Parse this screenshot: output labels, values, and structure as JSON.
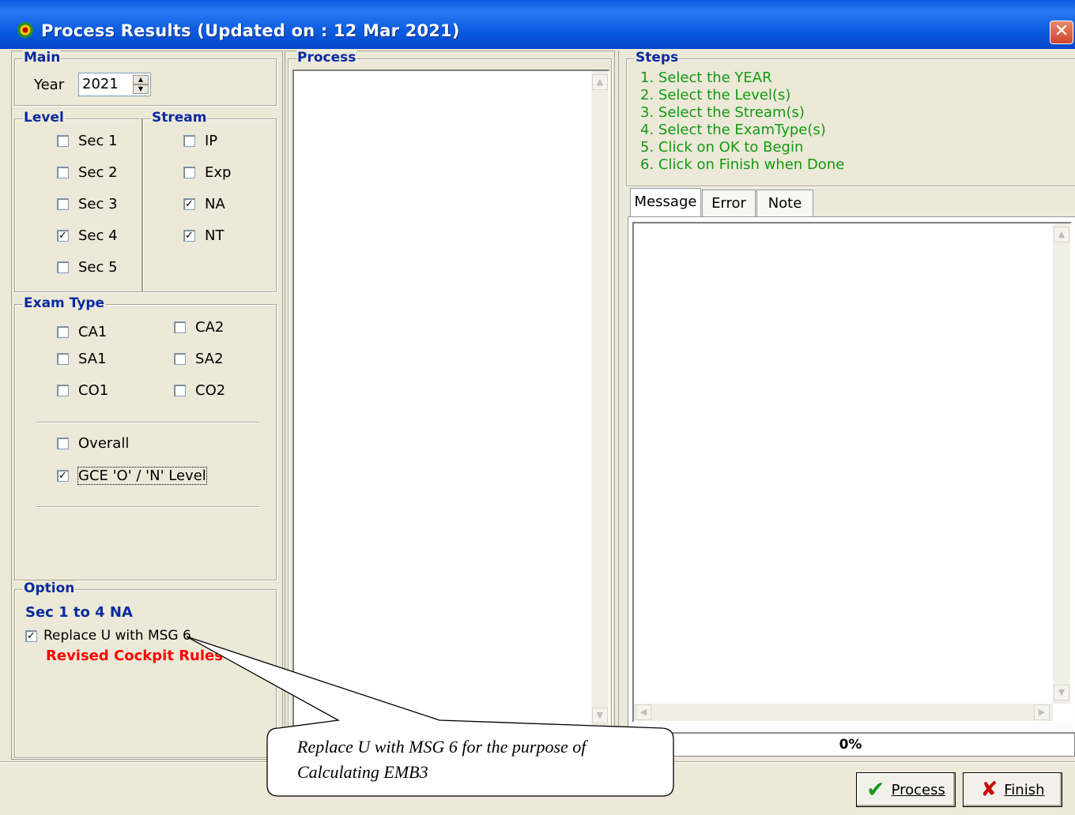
{
  "window": {
    "title": "Process Results (Updated on : 12 Mar 2021)",
    "close_label": "✕"
  },
  "main": {
    "legend": "Main",
    "year_label": "Year",
    "year_value": "2021"
  },
  "level": {
    "legend": "Level",
    "items": [
      {
        "label": "Sec 1",
        "checked": false
      },
      {
        "label": "Sec 2",
        "checked": false
      },
      {
        "label": "Sec 3",
        "checked": false
      },
      {
        "label": "Sec 4",
        "checked": true
      },
      {
        "label": "Sec 5",
        "checked": false
      }
    ]
  },
  "stream": {
    "legend": "Stream",
    "items": [
      {
        "label": "IP",
        "checked": false
      },
      {
        "label": "Exp",
        "checked": false
      },
      {
        "label": "NA",
        "checked": true
      },
      {
        "label": "NT",
        "checked": true
      }
    ]
  },
  "exam_type": {
    "legend": "Exam Type",
    "items": [
      {
        "label": "CA1",
        "checked": false
      },
      {
        "label": "CA2",
        "checked": false
      },
      {
        "label": "SA1",
        "checked": false
      },
      {
        "label": "SA2",
        "checked": false
      },
      {
        "label": "CO1",
        "checked": false
      },
      {
        "label": "CO2",
        "checked": false
      },
      {
        "label": "Overall",
        "checked": false
      },
      {
        "label": "GCE 'O' / 'N' Level",
        "checked": true
      }
    ]
  },
  "option": {
    "legend": "Option",
    "subtitle": "Sec 1 to 4 NA",
    "replace_label": "Replace U with MSG 6",
    "replace_checked": true,
    "rules_label": "Revised Cockpit Rules"
  },
  "process": {
    "legend": "Process"
  },
  "steps": {
    "legend": "Steps",
    "items": [
      "1.  Select the YEAR",
      "2.  Select the Level(s)",
      "3.  Select the Stream(s)",
      "4.  Select the ExamType(s)",
      "5.  Click on OK to Begin",
      "6.  Click on Finish when Done"
    ]
  },
  "tabs": [
    "Message",
    "Error",
    "Note"
  ],
  "progress": {
    "label": "0%",
    "value": 0
  },
  "buttons": {
    "process": "Process",
    "finish": "Finish"
  },
  "callout": {
    "text": "Replace U with MSG 6 for the purpose of Calculating EMB3"
  },
  "colors": {
    "legend": "#0a2aa0",
    "steps": "#119a11",
    "rules": "#ff0000"
  }
}
